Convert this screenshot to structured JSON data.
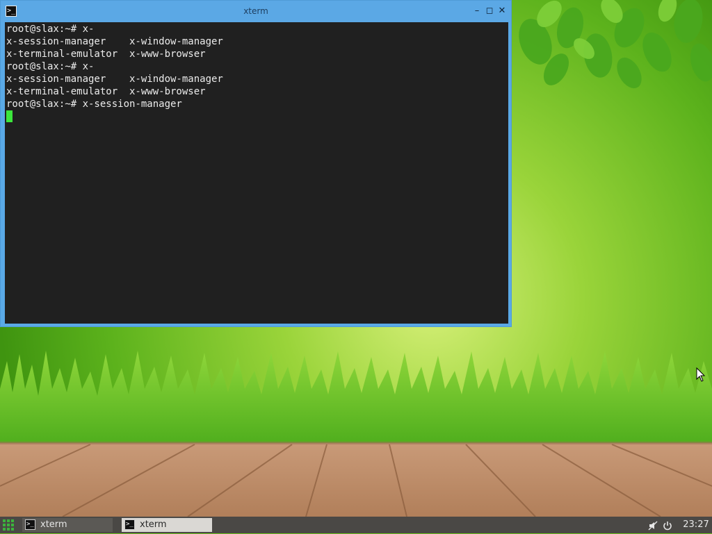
{
  "window": {
    "title": "xterm",
    "buttons": {
      "minimize": "–",
      "maximize": "◻",
      "close": "✕"
    },
    "icon": "terminal-icon"
  },
  "terminal": {
    "lines": [
      "root@slax:~# x-",
      "x-session-manager    x-window-manager",
      "x-terminal-emulator  x-www-browser",
      "root@slax:~# x-",
      "x-session-manager    x-window-manager",
      "x-terminal-emulator  x-www-browser",
      "root@slax:~# x-session-manager"
    ],
    "cursor_color": "#3ce63c"
  },
  "taskbar": {
    "menu_icon": "app-grid-icon",
    "tasks": [
      {
        "label": "xterm",
        "icon": "terminal-icon",
        "active": false
      },
      {
        "label": "xterm",
        "icon": "terminal-icon",
        "active": true
      }
    ],
    "tray": {
      "volume_icon": "volume-muted-icon",
      "power_icon": "power-icon"
    },
    "clock": "23:27"
  },
  "colors": {
    "titlebar": "#5ba8e5",
    "terminal_bg": "#202020",
    "taskbar": "#4a4845",
    "accent": "#3cb43c"
  }
}
